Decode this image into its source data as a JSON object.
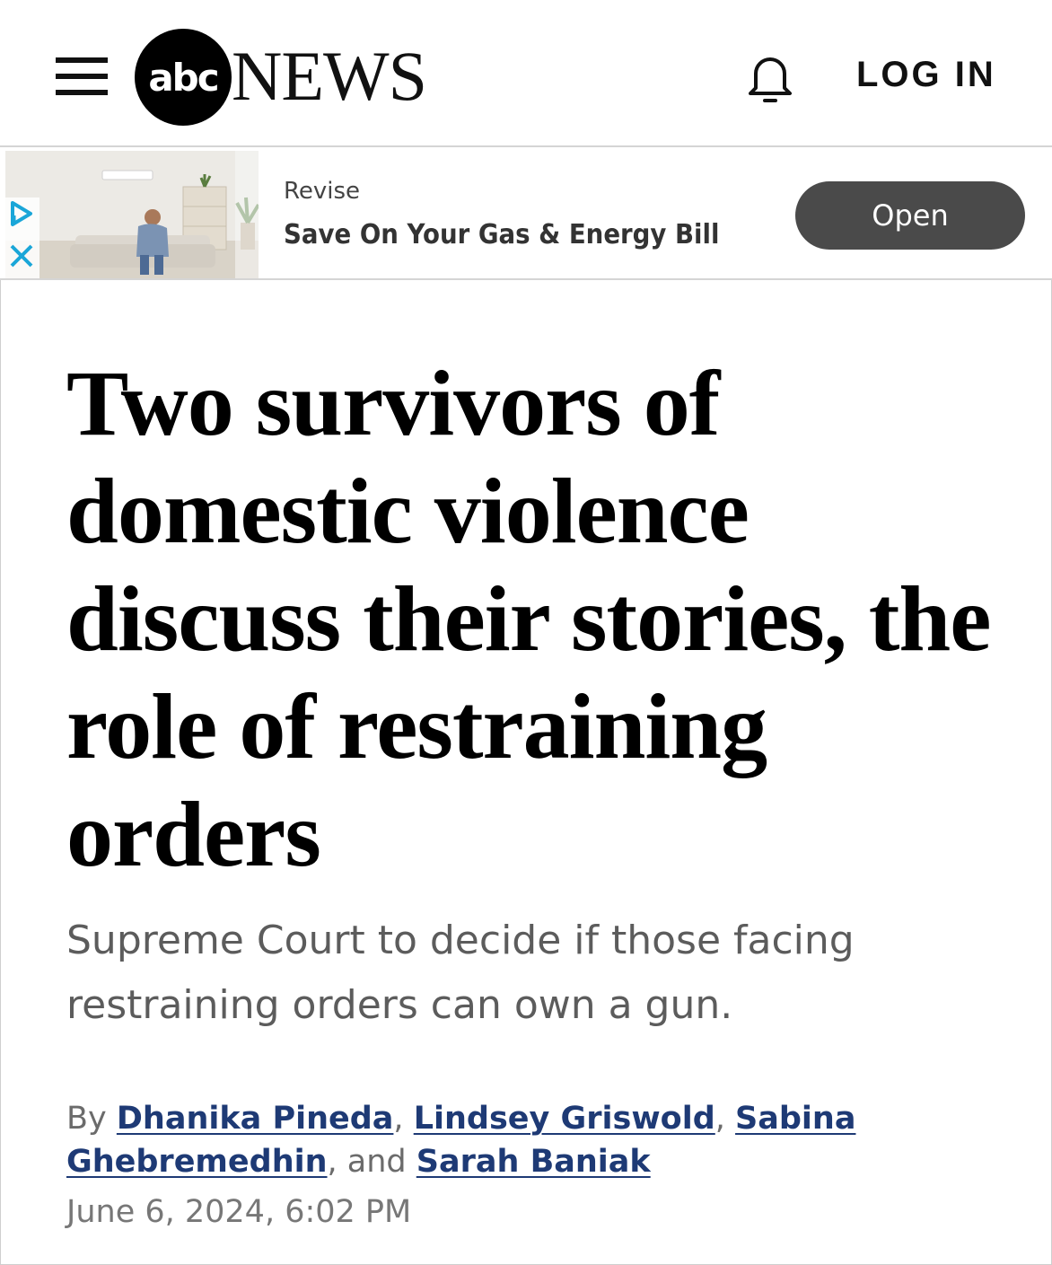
{
  "header": {
    "logo_abc": "abc",
    "logo_news": "NEWS",
    "login_label": "LOG IN",
    "menu_icon": "hamburger-menu-icon",
    "notification_icon": "bell-icon"
  },
  "ad": {
    "brand": "Revise",
    "title": "Save On Your Gas & Energy Bill",
    "button_label": "Open",
    "adchoices_icon": "adchoices-icon",
    "close_icon": "close-icon"
  },
  "article": {
    "headline": "Two survivors of domestic violence discuss their stories, the role of restraining orders",
    "subhead": "Supreme Court to decide if those facing restraining orders can own a gun.",
    "byline": {
      "prefix": "By ",
      "authors": [
        "Dhanika Pineda",
        "Lindsey Griswold",
        "Sabina Ghebremedhin",
        "Sarah Baniak"
      ],
      "sep1": ", ",
      "sep2": ", ",
      "sep3": ", and "
    },
    "date": "June 6, 2024, 6:02 PM"
  },
  "colors": {
    "author_link": "#1e3a75",
    "ad_button": "#4a4a4a",
    "adchoices": "#1aa6d8"
  }
}
